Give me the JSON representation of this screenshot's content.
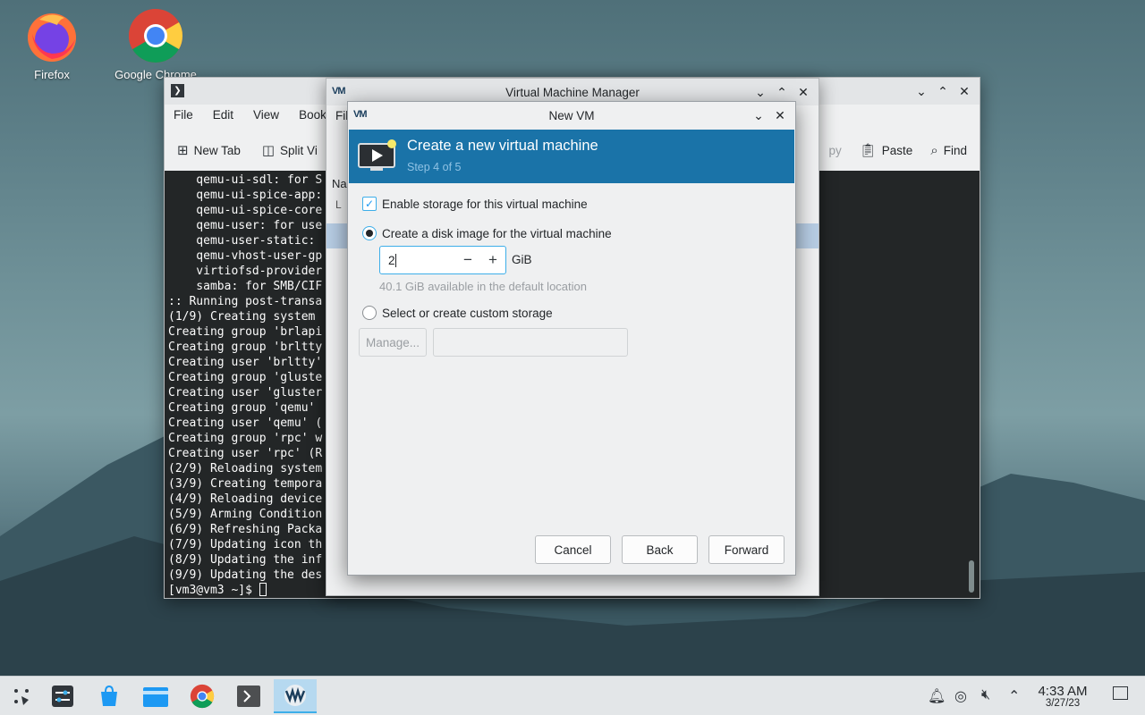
{
  "desktop": {
    "icons": [
      {
        "label": "Firefox"
      },
      {
        "label": "Google Chrome"
      }
    ]
  },
  "konsole": {
    "menu": [
      "File",
      "Edit",
      "View",
      "Bookm"
    ],
    "toolbar": {
      "new_tab": "New Tab",
      "split": "Split Vi",
      "copy_partial": "py",
      "paste": "Paste",
      "find": "Find"
    },
    "lines": [
      "    qemu-ui-sdl: for S",
      "    qemu-ui-spice-app:",
      "    qemu-ui-spice-core",
      "    qemu-user: for use",
      "    qemu-user-static:",
      "    qemu-vhost-user-gp",
      "    virtiofsd-provider",
      "    samba: for SMB/CIF",
      ":: Running post-transa",
      "(1/9) Creating system",
      "Creating group 'brlapi",
      "Creating group 'brltty",
      "Creating user 'brltty'",
      "Creating group 'gluste",
      "Creating user 'gluster",
      "Creating group 'qemu'",
      "Creating user 'qemu' (",
      "Creating group 'rpc' w",
      "Creating user 'rpc' (R",
      "(2/9) Reloading system",
      "(3/9) Creating tempora",
      "(4/9) Reloading device",
      "(5/9) Arming Condition",
      "(6/9) Refreshing Packa",
      "(7/9) Updating icon th",
      "(8/9) Updating the inf",
      "(9/9) Updating the des"
    ],
    "prompt": "[vm3@vm3 ~]$ "
  },
  "vmm": {
    "title": "Virtual Machine Manager",
    "menu_partial": "Fil",
    "name_partial": "Na",
    "list_partial": "L"
  },
  "newvm": {
    "title": "New VM",
    "banner_title": "Create a new virtual machine",
    "banner_step": "Step 4 of 5",
    "enable_storage": "Enable storage for this virtual machine",
    "create_disk": "Create a disk image for the virtual machine",
    "size_value": "2",
    "size_unit": "GiB",
    "available": "40.1 GiB available in the default location",
    "custom_storage": "Select or create custom storage",
    "manage": "Manage...",
    "cancel": "Cancel",
    "back": "Back",
    "forward": "Forward"
  },
  "taskbar": {
    "time": "4:33 AM",
    "date": "3/27/23"
  }
}
